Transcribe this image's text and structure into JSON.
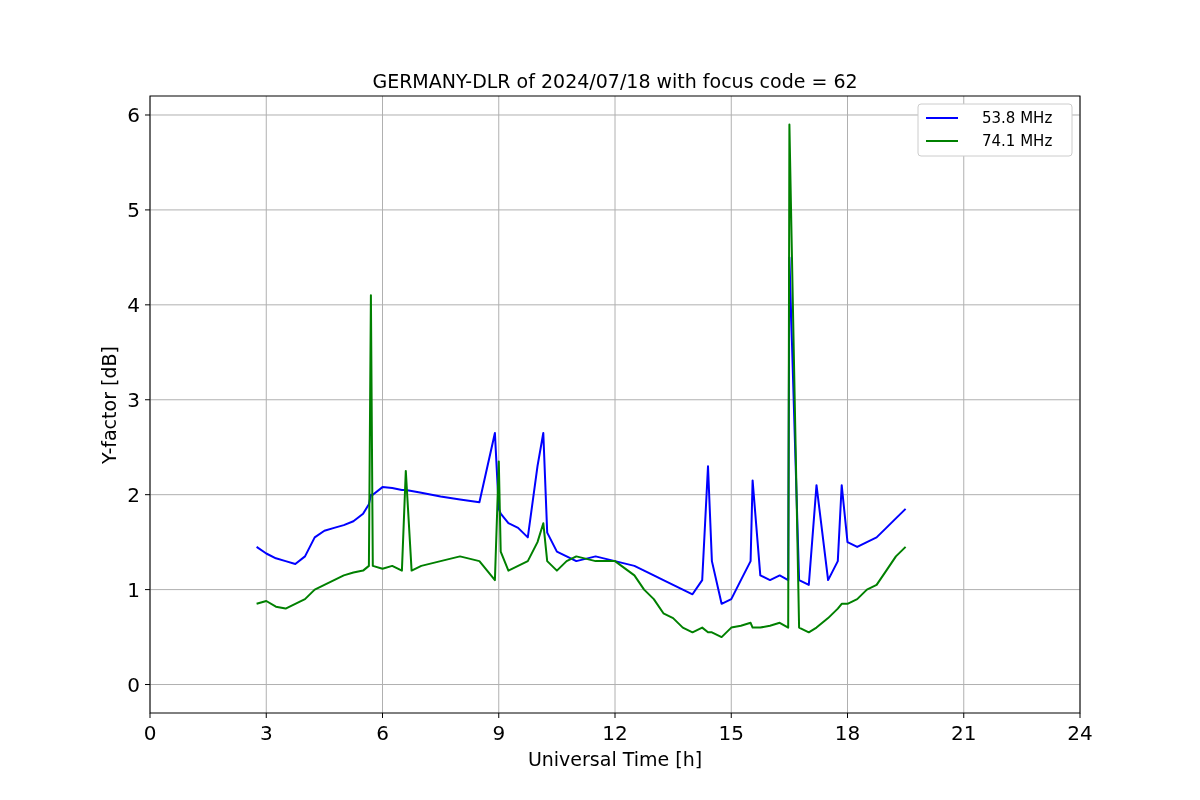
{
  "chart_data": {
    "type": "line",
    "title": "GERMANY-DLR of 2024/07/18 with focus code = 62",
    "xlabel": "Universal Time [h]",
    "ylabel": "Y-factor [dB]",
    "xlim": [
      0,
      24
    ],
    "ylim": [
      -0.3,
      6.2
    ],
    "xticks": [
      0,
      3,
      6,
      9,
      12,
      15,
      18,
      21,
      24
    ],
    "grid": true,
    "legend": true,
    "yticks": [
      0,
      1,
      2,
      3,
      4,
      5,
      6
    ],
    "x": [
      2.75,
      3.0,
      3.25,
      3.5,
      3.75,
      4.0,
      4.25,
      4.5,
      4.75,
      5.0,
      5.25,
      5.5,
      5.65,
      5.7,
      5.75,
      6.0,
      6.25,
      6.5,
      6.6,
      6.75,
      7.0,
      7.5,
      8.0,
      8.5,
      8.9,
      9.0,
      9.05,
      9.25,
      9.5,
      9.75,
      10.0,
      10.15,
      10.25,
      10.5,
      10.75,
      11.0,
      11.5,
      12.0,
      12.5,
      12.75,
      13.0,
      13.25,
      13.5,
      13.75,
      14.0,
      14.25,
      14.4,
      14.5,
      14.75,
      15.0,
      15.25,
      15.5,
      15.55,
      15.75,
      16.0,
      16.25,
      16.47,
      16.5,
      16.75,
      17.0,
      17.2,
      17.5,
      17.75,
      17.85,
      18.0,
      18.25,
      18.5,
      18.75,
      19.0,
      19.25,
      19.5
    ],
    "series": [
      {
        "name": "53.8 MHz",
        "color": "#0000ff",
        "values": [
          1.45,
          1.38,
          1.33,
          1.3,
          1.27,
          1.35,
          1.55,
          1.62,
          1.65,
          1.68,
          1.72,
          1.8,
          1.9,
          2.0,
          2.0,
          2.08,
          2.07,
          2.05,
          2.05,
          2.04,
          2.02,
          1.98,
          1.95,
          1.92,
          2.65,
          1.85,
          1.8,
          1.7,
          1.65,
          1.55,
          2.3,
          2.65,
          1.6,
          1.4,
          1.35,
          1.3,
          1.35,
          1.3,
          1.25,
          1.2,
          1.15,
          1.1,
          1.05,
          1.0,
          0.95,
          1.1,
          2.3,
          1.3,
          0.85,
          0.9,
          1.1,
          1.3,
          2.15,
          1.15,
          1.1,
          1.15,
          1.1,
          4.5,
          1.1,
          1.05,
          2.1,
          1.1,
          1.3,
          2.1,
          1.5,
          1.45,
          1.5,
          1.55,
          1.65,
          1.75,
          1.85
        ]
      },
      {
        "name": "74.1 MHz",
        "color": "#008000",
        "values": [
          0.85,
          0.88,
          0.82,
          0.8,
          0.85,
          0.9,
          1.0,
          1.05,
          1.1,
          1.15,
          1.18,
          1.2,
          1.25,
          4.1,
          1.25,
          1.22,
          1.25,
          1.2,
          2.25,
          1.2,
          1.25,
          1.3,
          1.35,
          1.3,
          1.1,
          2.35,
          1.4,
          1.2,
          1.25,
          1.3,
          1.5,
          1.7,
          1.3,
          1.2,
          1.3,
          1.35,
          1.3,
          1.3,
          1.15,
          1.0,
          0.9,
          0.75,
          0.7,
          0.6,
          0.55,
          0.6,
          0.55,
          0.55,
          0.5,
          0.6,
          0.62,
          0.65,
          0.6,
          0.6,
          0.62,
          0.65,
          0.6,
          5.9,
          0.6,
          0.55,
          0.6,
          0.7,
          0.8,
          0.85,
          0.85,
          0.9,
          1.0,
          1.05,
          1.2,
          1.35,
          1.45
        ]
      }
    ]
  }
}
